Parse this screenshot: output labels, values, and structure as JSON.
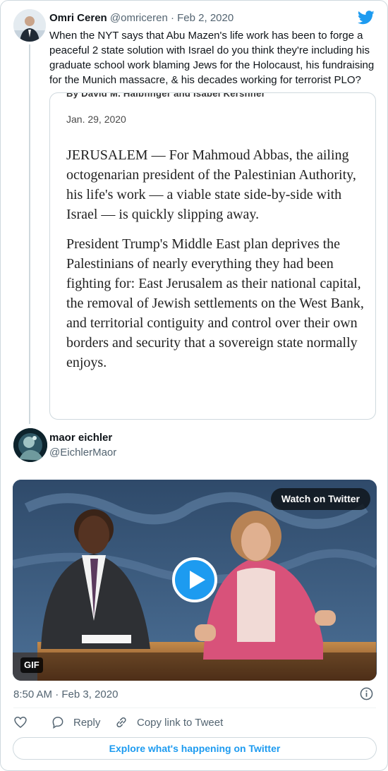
{
  "quoted_tweet": {
    "author_name": "Omri Ceren",
    "handle": "@omriceren",
    "separator": "·",
    "date": "Feb 2, 2020",
    "text": "When the NYT says that Abu Mazen's life work has been to forge a peaceful 2 state solution with Israel do you think they're including his graduate school work blaming Jews for the Holocaust, his fundraising for the Munich massacre, & his decades working for terrorist PLO?",
    "article": {
      "byline": "By David M. Halbfinger and Isabel Kershner",
      "date": "Jan. 29, 2020",
      "paragraphs": [
        "JERUSALEM — For Mahmoud Abbas, the ailing octogenarian president of the Palestinian Authority, his life's work — a viable state side-by-side with Israel — is quickly slipping away.",
        "President Trump's Middle East plan deprives the Palestinians of nearly everything they had been fighting for: East Jerusalem as their national capital, the removal of Jewish settlements on the West Bank, and territorial contiguity and control over their own borders and security that a sovereign state normally enjoys."
      ]
    }
  },
  "reply_tweet": {
    "author_name": "maor eichler",
    "handle": "@EichlerMaor",
    "media": {
      "watch_label": "Watch on Twitter",
      "badge": "GIF"
    },
    "timestamp": "8:50 AM · Feb 3, 2020",
    "actions": {
      "reply": "Reply",
      "copy_link": "Copy link to Tweet"
    },
    "explore_label": "Explore what's happening on Twitter"
  },
  "colors": {
    "accent": "#1d9bf0",
    "secondary_text": "#536471",
    "border": "#cfd9de"
  },
  "icons": [
    "twitter-bird-icon",
    "info-icon",
    "heart-icon",
    "reply-icon",
    "link-icon",
    "play-icon"
  ]
}
